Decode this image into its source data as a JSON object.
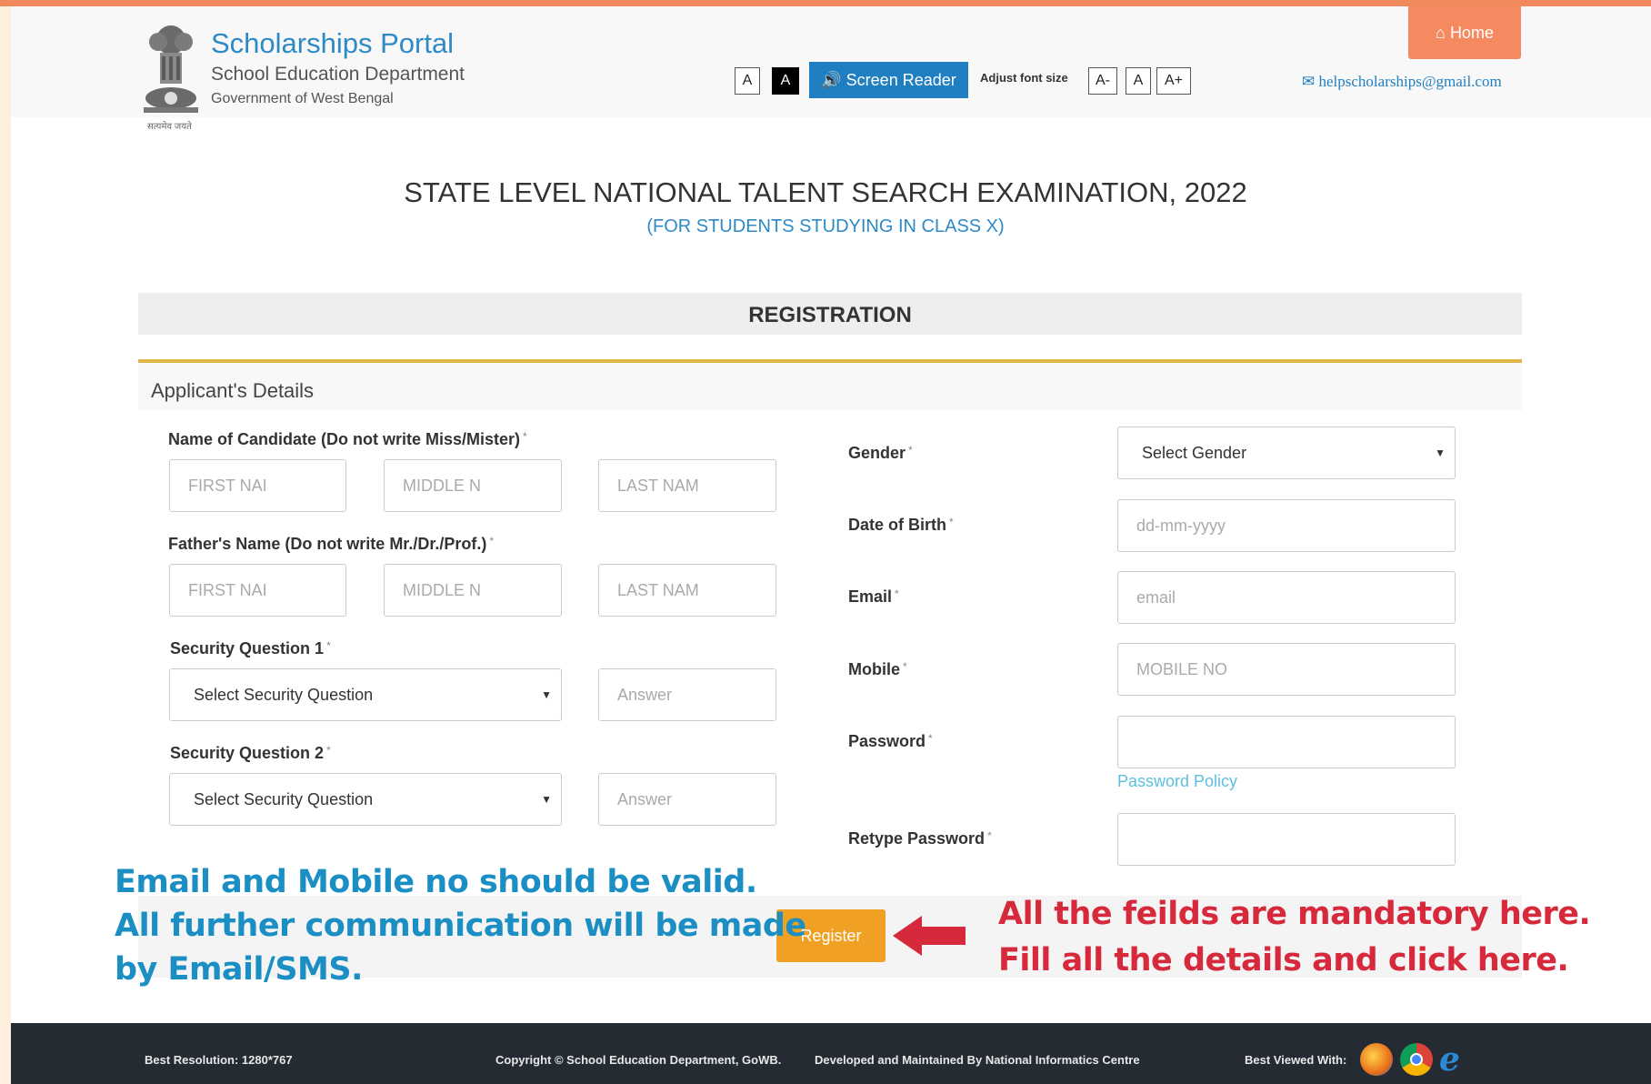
{
  "header": {
    "portal_title": "Scholarships Portal",
    "department": "School Education Department",
    "government": "Government of West Bengal",
    "emblem_caption": "सत्यमेव जयते",
    "contrast_normal": "A",
    "contrast_dark": "A",
    "screen_reader": "Screen Reader",
    "adjust_font_label": "Adjust font size",
    "font_decrease": "A-",
    "font_normal": "A",
    "font_increase": "A+",
    "home": "Home",
    "help_email": "helpscholarships@gmail.com"
  },
  "exam": {
    "title": "STATE LEVEL NATIONAL TALENT SEARCH EXAMINATION, 2022",
    "subtitle": "(FOR STUDENTS STUDYING IN CLASS X)"
  },
  "registration": {
    "title": "REGISTRATION",
    "section": "Applicant's Details",
    "required_mark": "*"
  },
  "form": {
    "candidate_label": "Name of Candidate (Do not write Miss/Mister)",
    "first_name_ph": "FIRST NAI",
    "middle_name_ph": "MIDDLE N",
    "last_name_ph": "LAST NAM",
    "father_label": "Father's Name (Do not write Mr./Dr./Prof.)",
    "sq1_label": "Security Question 1",
    "sq2_label": "Security Question 2",
    "sq_select": "Select Security Question",
    "answer_ph": "Answer",
    "gender_label": "Gender",
    "gender_select": "Select Gender",
    "dob_label": "Date of Birth",
    "dob_ph": "dd-mm-yyyy",
    "email_label": "Email",
    "email_ph": "email",
    "mobile_label": "Mobile",
    "mobile_ph": "MOBILE NO",
    "password_label": "Password",
    "password_policy": "Password Policy",
    "retype_label": "Retype Password",
    "register": "Register"
  },
  "notes": {
    "left_1": "Email and Mobile no should be valid.",
    "left_2": "All further communication will be made",
    "left_3": "by Email/SMS.",
    "right_1": "All the feilds are mandatory here.",
    "right_2": "Fill all the details and click here."
  },
  "footer": {
    "resolution": "Best Resolution: 1280*767",
    "copyright": "Copyright © School Education Department, GoWB.",
    "developed": "Developed and Maintained By National Informatics Centre",
    "best_viewed": "Best Viewed With:"
  },
  "colors": {
    "accent_blue": "#2d8ac6",
    "home_orange": "#f58a60",
    "register_orange": "#f0a023",
    "note_blue": "#1b8fc4",
    "note_red": "#d6293b",
    "footer_bg": "#242b33"
  },
  "icons": {
    "home": "home-icon",
    "speaker": "speaker-icon",
    "mail": "envelope-icon",
    "browsers": [
      "firefox-icon",
      "chrome-icon",
      "internet-explorer-icon"
    ]
  }
}
